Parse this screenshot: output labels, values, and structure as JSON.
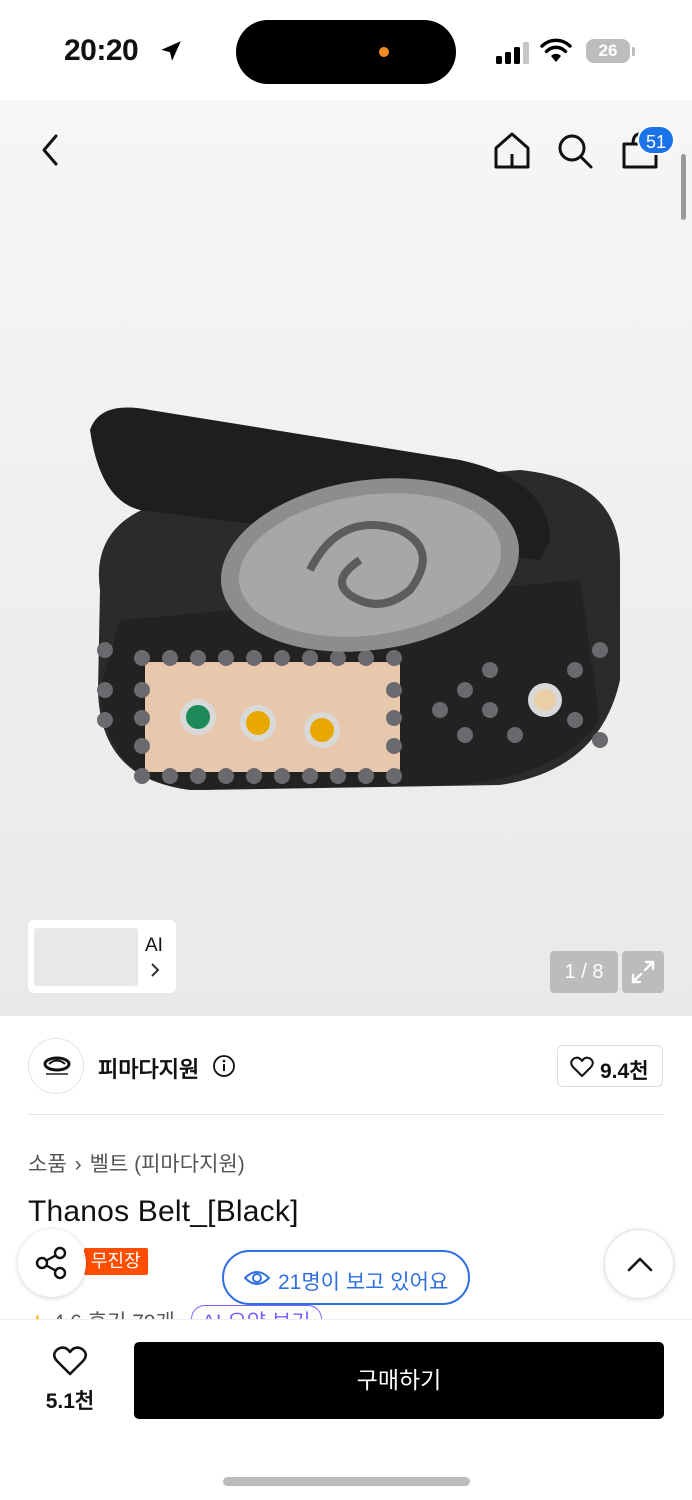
{
  "status_bar": {
    "time": "20:20",
    "battery": "26"
  },
  "nav": {
    "cart_count": "51"
  },
  "gallery": {
    "ai_label": "AI",
    "counter": "1 / 8"
  },
  "seller": {
    "name": "피마다지원",
    "likes": "9.4천"
  },
  "breadcrumb": {
    "category": "소품",
    "sub": "벨트 (피마다지원)"
  },
  "product": {
    "title": "Thanos Belt_[Black]",
    "tag": "무진장",
    "viewers": "21명이 보고 있어요",
    "rating": "4.6",
    "reviews": "후기 79개",
    "ai_summary": "AI 요약 보기"
  },
  "bottom_bar": {
    "like_count": "5.1천",
    "buy_label": "구매하기"
  },
  "colors": {
    "accent_blue": "#2f6fe0",
    "tag_orange": "#ff4d00",
    "buy_black": "#000000"
  }
}
